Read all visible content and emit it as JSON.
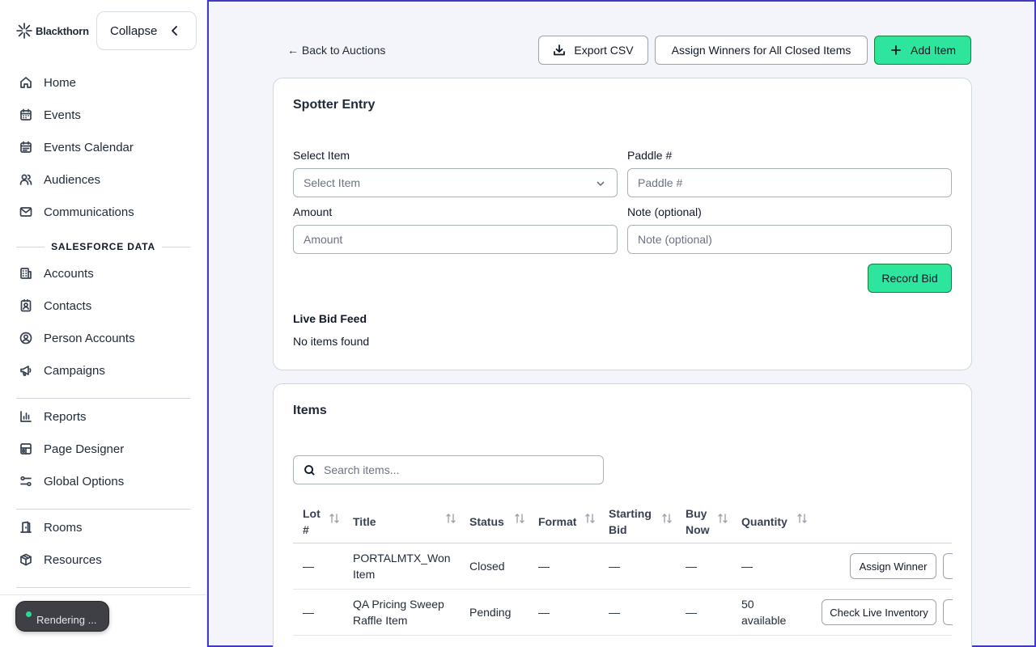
{
  "brand": {
    "name": "Blackthorn"
  },
  "sidebar": {
    "collapse_label": "Collapse",
    "items_top": [
      {
        "label": "Home",
        "icon": "home-icon"
      },
      {
        "label": "Events",
        "icon": "calendar-icon"
      },
      {
        "label": "Events Calendar",
        "icon": "calendar-grid-icon"
      },
      {
        "label": "Audiences",
        "icon": "users-icon"
      },
      {
        "label": "Communications",
        "icon": "mail-icon"
      }
    ],
    "section_title": "SALESFORCE DATA",
    "items_sf": [
      {
        "label": "Accounts",
        "icon": "building-icon"
      },
      {
        "label": "Contacts",
        "icon": "contact-card-icon"
      },
      {
        "label": "Person Accounts",
        "icon": "user-circle-icon"
      },
      {
        "label": "Campaigns",
        "icon": "megaphone-icon"
      }
    ],
    "items_tools": [
      {
        "label": "Reports",
        "icon": "bar-chart-icon"
      },
      {
        "label": "Page Designer",
        "icon": "layout-icon"
      },
      {
        "label": "Global Options",
        "icon": "sliders-icon"
      }
    ],
    "items_venue": [
      {
        "label": "Rooms",
        "icon": "door-icon"
      },
      {
        "label": "Resources",
        "icon": "box-icon"
      }
    ],
    "toast": "Rendering ..."
  },
  "toolbar": {
    "back_label": "← Back to Auctions",
    "export_label": "Export CSV",
    "assign_all_label": "Assign Winners for All Closed Items",
    "add_item_label": "Add Item"
  },
  "spotter": {
    "title": "Spotter Entry",
    "select_item_label": "Select Item",
    "select_item_value": "Select Item",
    "paddle_label": "Paddle #",
    "paddle_placeholder": "Paddle #",
    "amount_label": "Amount",
    "amount_placeholder": "Amount",
    "note_label": "Note (optional)",
    "note_placeholder": "Note (optional)",
    "record_bid_label": "Record Bid",
    "feed_title": "Live Bid Feed",
    "feed_empty": "No items found"
  },
  "items": {
    "title": "Items",
    "search_placeholder": "Search items...",
    "columns": {
      "lot": "Lot #",
      "title": "Title",
      "status": "Status",
      "format": "Format",
      "starting_bid": "Starting Bid",
      "buy_now": "Buy Now",
      "quantity": "Quantity"
    },
    "rows": [
      {
        "lot": "—",
        "title": "PORTALMTX_Won Item",
        "status": "Closed",
        "format": "—",
        "starting_bid": "—",
        "buy_now": "—",
        "quantity": "—",
        "action": "Assign Winner"
      },
      {
        "lot": "—",
        "title": "QA Pricing Sweep Raffle Item",
        "status": "Pending",
        "format": "—",
        "starting_bid": "—",
        "buy_now": "—",
        "quantity": "50 available",
        "action": "Check Live Inventory"
      }
    ]
  },
  "colors": {
    "accent_green": "#2ee59d",
    "main_bg": "#f4f5fb",
    "focus_border": "#4338ca"
  }
}
